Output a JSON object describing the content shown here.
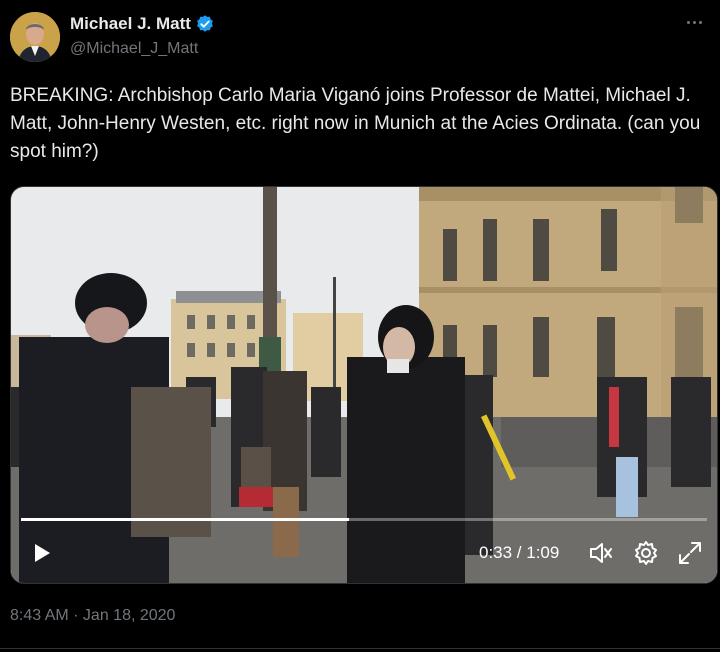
{
  "author": {
    "display_name": "Michael J. Matt",
    "handle": "@Michael_J_Matt",
    "verified": true,
    "avatar_icon": "profile-photo",
    "verified_color": "#1d9bf0"
  },
  "tweet": {
    "text": "BREAKING: Archbishop Carlo Maria Viganó joins Professor de Mattei, Michael J. Matt, John-Henry Westen, etc. right now in Munich at the Acies Ordinata. (can you spot him?)",
    "timestamp": "8:43 AM · Jan 18, 2020"
  },
  "video": {
    "time_display": "0:33 / 1:09",
    "progress_fraction": 0.478,
    "icons": [
      "play-icon",
      "volume-icon",
      "settings-icon",
      "fullscreen-icon"
    ]
  },
  "colors": {
    "background": "#000000",
    "text": "#e7e9ea",
    "secondary_text": "#71767b"
  }
}
